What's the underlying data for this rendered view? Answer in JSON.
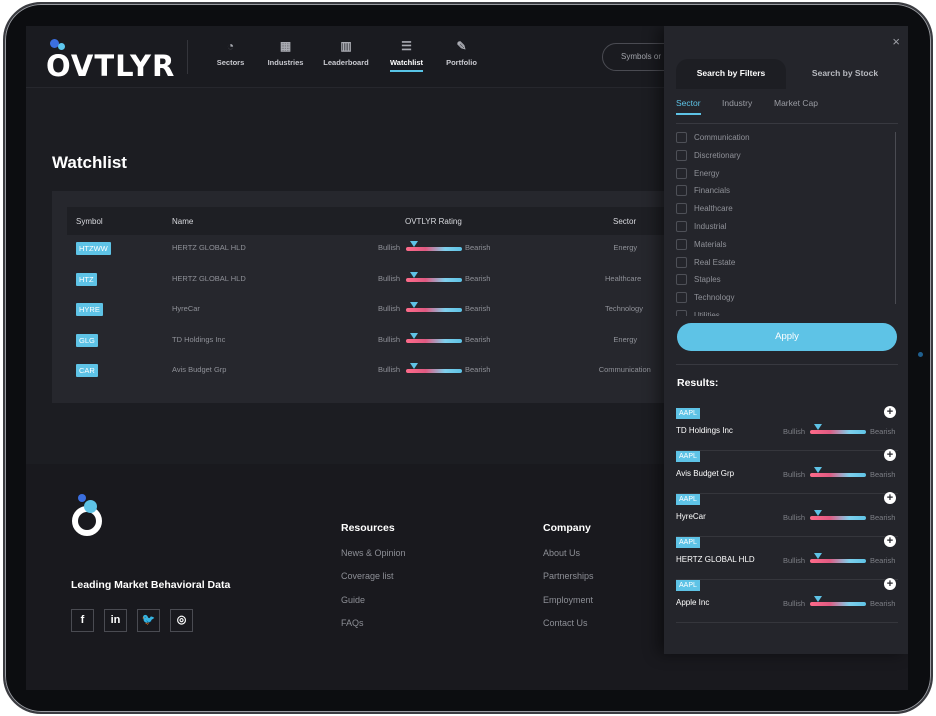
{
  "app": {
    "logo_text": "OVTLYR"
  },
  "nav": [
    {
      "label": "Sectors",
      "icon": "pie-chart-icon"
    },
    {
      "label": "Industries",
      "icon": "building-icon"
    },
    {
      "label": "Leaderboard",
      "icon": "bar-chart-icon"
    },
    {
      "label": "Watchlist",
      "icon": "list-icon",
      "active": true
    },
    {
      "label": "Portfolio",
      "icon": "pencil-icon"
    }
  ],
  "search": {
    "placeholder": "Symbols or"
  },
  "watchlist": {
    "title": "Watchlist",
    "columns": {
      "symbol": "Symbol",
      "name": "Name",
      "rating": "OVTLYR Rating",
      "sector": "Sector"
    },
    "rows": [
      {
        "symbol": "HTZWW",
        "name": "HERTZ GLOBAL HLD",
        "bull": "Bullish",
        "bear": "Bearish",
        "sector": "Energy",
        "rating_position": 0.15
      },
      {
        "symbol": "HTZ",
        "name": "HERTZ GLOBAL HLD",
        "bull": "Bullish",
        "bear": "Bearish",
        "sector": "Healthcare",
        "rating_position": 0.15
      },
      {
        "symbol": "HYRE",
        "name": "HyreCar",
        "bull": "Bullish",
        "bear": "Bearish",
        "sector": "Technology",
        "rating_position": 0.15
      },
      {
        "symbol": "GLG",
        "name": "TD Holdings Inc",
        "bull": "Bullish",
        "bear": "Bearish",
        "sector": "Energy",
        "rating_position": 0.15
      },
      {
        "symbol": "CAR",
        "name": "Avis Budget Grp",
        "bull": "Bullish",
        "bear": "Bearish",
        "sector": "Communication",
        "rating_position": 0.15
      }
    ]
  },
  "footer": {
    "tagline": "Leading Market Behavioral Data",
    "social": [
      {
        "label": "f",
        "icon": "facebook-icon"
      },
      {
        "label": "in",
        "icon": "linkedin-icon"
      },
      {
        "label": "🐦",
        "icon": "twitter-icon"
      },
      {
        "label": "◎",
        "icon": "instagram-icon"
      }
    ],
    "resources": {
      "title": "Resources",
      "links": [
        "News & Opinion",
        "Coverage list",
        "Guide",
        "FAQs"
      ]
    },
    "company": {
      "title": "Company",
      "links": [
        "About Us",
        "Partnerships",
        "Employment",
        "Contact Us"
      ]
    }
  },
  "panel": {
    "close": "×",
    "tabs": [
      "Search by Filters",
      "Search by Stock"
    ],
    "filter_tabs": [
      "Sector",
      "Industry",
      "Market Cap"
    ],
    "sectors": [
      "Communication",
      "Discretionary",
      "Energy",
      "Financials",
      "Healthcare",
      "Industrial",
      "Materials",
      "Real Estate",
      "Staples",
      "Technology",
      "Utilities"
    ],
    "apply": "Apply",
    "results_title": "Results:",
    "results": [
      {
        "symbol": "AAPL",
        "name": "TD Holdings Inc",
        "bull": "Bullish",
        "bear": "Bearish",
        "rating_position": 0.15
      },
      {
        "symbol": "AAPL",
        "name": "Avis Budget Grp",
        "bull": "Bullish",
        "bear": "Bearish",
        "rating_position": 0.15
      },
      {
        "symbol": "AAPL",
        "name": "HyreCar",
        "bull": "Bullish",
        "bear": "Bearish",
        "rating_position": 0.15
      },
      {
        "symbol": "AAPL",
        "name": "HERTZ GLOBAL HLD",
        "bull": "Bullish",
        "bear": "Bearish",
        "rating_position": 0.15
      },
      {
        "symbol": "AAPL",
        "name": "Apple Inc",
        "bull": "Bullish",
        "bear": "Bearish",
        "rating_position": 0.15
      }
    ]
  },
  "colors": {
    "accent": "#5ec3e6",
    "bg": "#1c1d22",
    "card": "#26272d"
  }
}
